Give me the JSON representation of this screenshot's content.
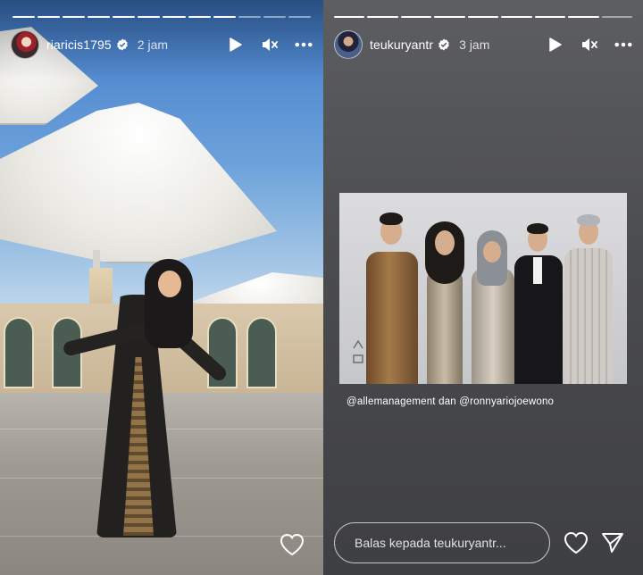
{
  "left_story": {
    "username": "riaricis1795",
    "time": "2 jam",
    "progress_segments": 12,
    "progress_done": 9,
    "icons": [
      "play-icon",
      "mute-icon",
      "more-icon",
      "heart-icon"
    ]
  },
  "right_story": {
    "username": "teukuryantr",
    "time": "3 jam",
    "progress_segments": 9,
    "progress_done": 8,
    "caption": "@allemanagement dan @ronnyariojoewono",
    "reply_placeholder": "Balas kepada teukuryantr...",
    "icons": [
      "play-icon",
      "mute-icon",
      "more-icon",
      "heart-icon",
      "send-icon"
    ]
  },
  "colors": {
    "right_background": "#535458",
    "text": "#ffffff"
  }
}
